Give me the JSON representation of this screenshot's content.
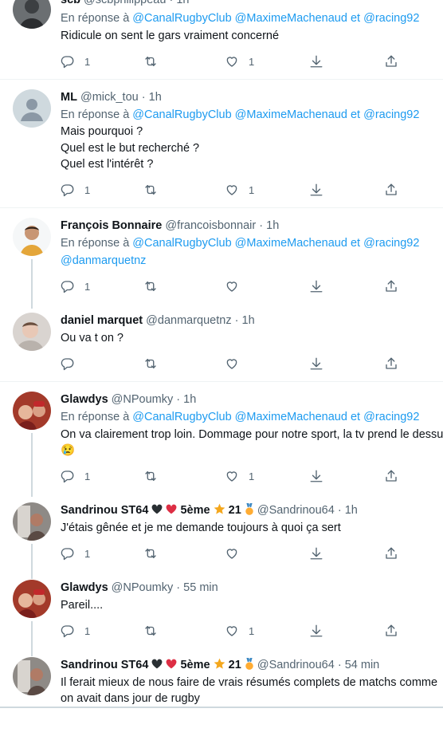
{
  "tweets": [
    {
      "name": "scb",
      "handle": "@scbphilippeau",
      "time": "1h",
      "reply_prefix": "En réponse à",
      "mentions": [
        "@CanalRugbyClub",
        "@MaximeMachenaud",
        "et",
        "@racing92"
      ],
      "lines": [
        "Ridicule on sent le gars vraiment concerné"
      ],
      "replies": "1",
      "retweets": "",
      "likes": "1"
    },
    {
      "name": "ML",
      "handle": "@mick_tou",
      "time": "1h",
      "reply_prefix": "En réponse à",
      "mentions": [
        "@CanalRugbyClub",
        "@MaximeMachenaud",
        "et",
        "@racing92"
      ],
      "lines": [
        "Mais pourquoi ?",
        "Quel est le but recherché ?",
        "Quel est l'intérêt ?"
      ],
      "replies": "1",
      "retweets": "",
      "likes": "1"
    },
    {
      "name": "François Bonnaire",
      "handle": "@francoisbonnair",
      "time": "1h",
      "reply_prefix": "En réponse à",
      "mentions": [
        "@CanalRugbyClub",
        "@MaximeMachenaud",
        "et",
        "@racing92"
      ],
      "extra_mention": "@danmarquetnz",
      "lines": [],
      "replies": "1",
      "retweets": "",
      "likes": ""
    },
    {
      "name": "daniel marquet",
      "handle": "@danmarquetnz",
      "time": "1h",
      "lines": [
        "Ou va t on ?"
      ],
      "replies": "",
      "retweets": "",
      "likes": ""
    },
    {
      "name": "Glawdys",
      "handle": "@NPoumky",
      "time": "1h",
      "reply_prefix": "En réponse à",
      "mentions": [
        "@CanalRugbyClub",
        "@MaximeMachenaud",
        "et",
        "@racing92"
      ],
      "lines": [
        "On va clairement trop loin. Dommage pour notre sport, la tv prend le dessus",
        "😢"
      ],
      "replies": "1",
      "retweets": "",
      "likes": "1"
    },
    {
      "name": "Sandrinou ST64",
      "name_suffix": "5ème",
      "name_suffix2": "21",
      "handle": "@Sandrinou64",
      "time": "1h",
      "lines": [
        "J'étais gênée et je me demande toujours à quoi ça sert"
      ],
      "replies": "1",
      "retweets": "",
      "likes": ""
    },
    {
      "name": "Glawdys",
      "handle": "@NPoumky",
      "time": "55 min",
      "lines": [
        "Pareil...."
      ],
      "replies": "1",
      "retweets": "",
      "likes": "1"
    },
    {
      "name": "Sandrinou ST64",
      "name_suffix": "5ème",
      "name_suffix2": "21",
      "handle": "@Sandrinou64",
      "time": "54 min",
      "lines": [
        "Il ferait mieux de nous faire de vrais résumés complets de matchs comme",
        "on avait dans jour de rugby"
      ]
    }
  ],
  "separator": "·",
  "icons": [
    "reply-icon",
    "retweet-icon",
    "like-icon",
    "download-icon",
    "share-icon"
  ],
  "colors": {
    "link": "#1d9bf0",
    "secondary": "#536471",
    "text": "#0f1419"
  }
}
